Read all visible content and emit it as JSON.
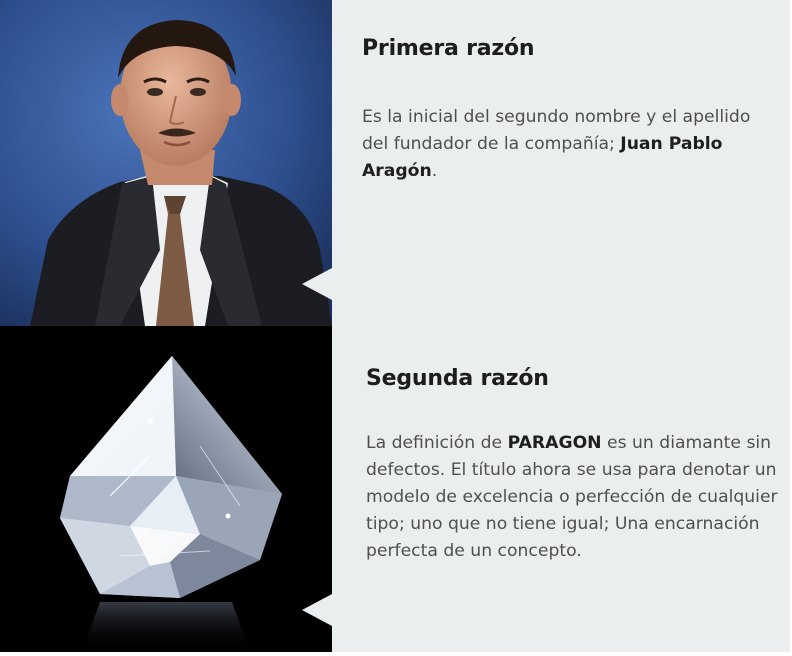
{
  "section1": {
    "title": "Primera razón",
    "text_before": "Es la inicial del segundo nombre y el apellido del fundador de la compañía; ",
    "founder_name": "Juan Pablo Aragón",
    "text_after": "."
  },
  "section2": {
    "title": "Segunda razón",
    "text_before": "La definición de ",
    "brand": "PARAGON",
    "text_after": " es un diamante sin defectos. El título ahora se usa para denotar un modelo de excelencia o perfección de cualquier tipo; uno que no tiene igual; Una encarnación perfecta de un concepto."
  },
  "colors": {
    "panel_bg": "#ebeeef",
    "heading": "#1d1d1d",
    "body_text": "#4f4f4f",
    "portrait_bg": "#2d4f8e",
    "diamond_bg": "#000000"
  },
  "images": {
    "portrait": "founder-portrait-photo",
    "diamond": "paragon-diamond-photo"
  }
}
